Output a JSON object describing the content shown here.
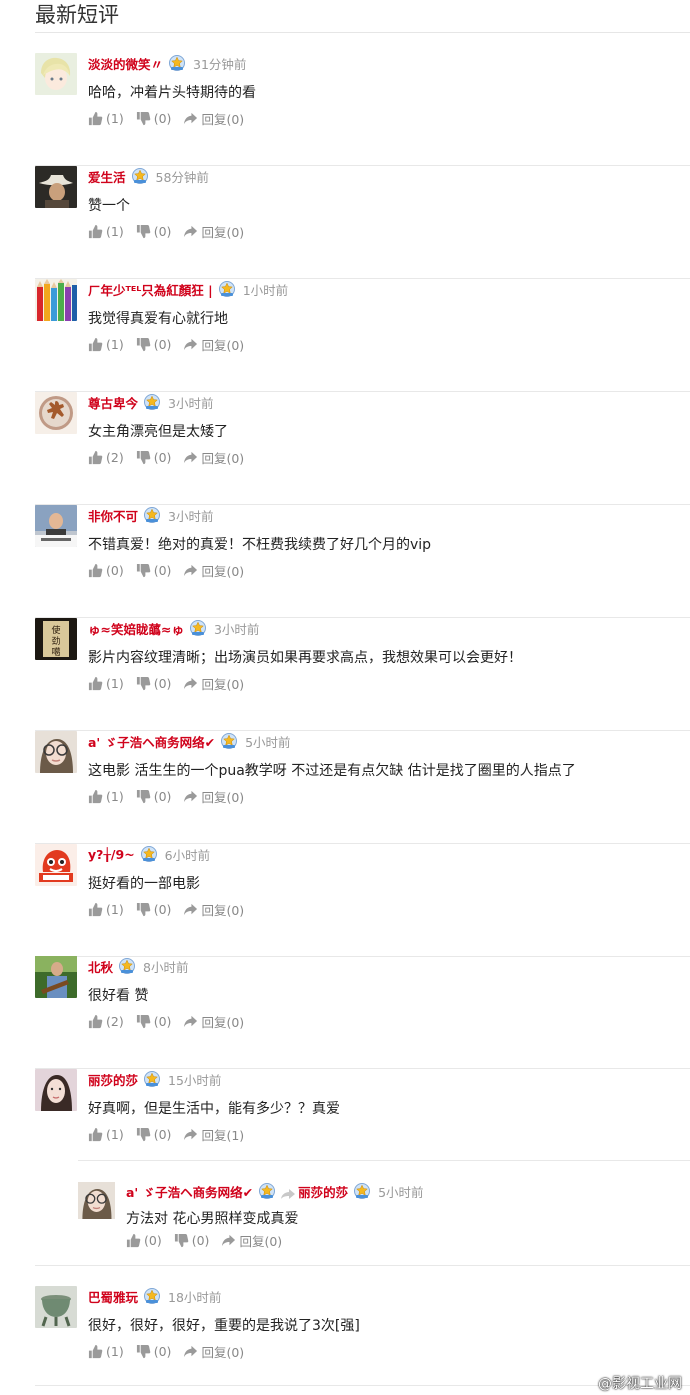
{
  "section": {
    "title": "最新短评"
  },
  "comments": [
    {
      "user": "淡淡的微笑〃",
      "time": "31分钟前",
      "text": "哈哈，冲着片头特期待的看",
      "like": "(1)",
      "dislike": "(0)",
      "reply": "回复(0)",
      "avatar": "anime-face"
    },
    {
      "user": "爱生活",
      "time": "58分钟前",
      "text": "赞一个",
      "like": "(1)",
      "dislike": "(0)",
      "reply": "回复(0)",
      "avatar": "cowboy"
    },
    {
      "user": "ㄏ年少ᵀᴱᴸ只為紅顏狂 |",
      "time": "1小时前",
      "text": "我觉得真爱有心就行地",
      "like": "(1)",
      "dislike": "(0)",
      "reply": "回复(0)",
      "avatar": "pencils"
    },
    {
      "user": "尊古卑今",
      "time": "3小时前",
      "text": "女主角漂亮但是太矮了",
      "like": "(2)",
      "dislike": "(0)",
      "reply": "回复(0)",
      "avatar": "cookie"
    },
    {
      "user": "非你不可",
      "time": "3小时前",
      "text": "不错真爱！绝对的真爱！不枉费我续费了好几个月的vip",
      "like": "(0)",
      "dislike": "(0)",
      "reply": "回复(0)",
      "avatar": "person-sign"
    },
    {
      "user": "ゅ≈笑婄眬蘤≈ゅ",
      "time": "3小时前",
      "text": "影片内容纹理清晰；出场演员如果再要求高点，我想效果可以会更好！",
      "like": "(1)",
      "dislike": "(0)",
      "reply": "回复(0)",
      "avatar": "calligraphy"
    },
    {
      "user": "a' ゞ子浩ヘ商务网络✔",
      "time": "5小时前",
      "text": "这电影 活生生的一个pua教学呀 不过还是有点欠缺 估计是找了圈里的人指点了",
      "like": "(1)",
      "dislike": "(0)",
      "reply": "回复(0)",
      "avatar": "girl"
    },
    {
      "user": "y?╁/9~",
      "time": "6小时前",
      "text": "挺好看的一部电影",
      "like": "(1)",
      "dislike": "(0)",
      "reply": "回复(0)",
      "avatar": "red-mascot"
    },
    {
      "user": "北秋",
      "time": "8小时前",
      "text": "很好看 赞",
      "like": "(2)",
      "dislike": "(0)",
      "reply": "回复(0)",
      "avatar": "guitar"
    },
    {
      "user": "丽莎的莎",
      "time": "15小时前",
      "text": "好真啊，但是生活中，能有多少？？真爱",
      "like": "(1)",
      "dislike": "(0)",
      "reply": "回复(1)",
      "avatar": "woman"
    },
    {
      "user": "巴蜀雅玩",
      "time": "18小时前",
      "text": "很好，很好，很好，重要的是我说了3次[强]",
      "like": "(1)",
      "dislike": "(0)",
      "reply": "回复(0)",
      "avatar": "vessel"
    }
  ],
  "reply": {
    "user": "a' ゞ子浩ヘ商务网络✔",
    "to_user": "丽莎的莎",
    "time": "5小时前",
    "text": "方法对 花心男照样变成真爱",
    "like": "(0)",
    "dislike": "(0)",
    "reply": "回复(0)",
    "avatar": "girl"
  },
  "watermark": "@影视工业网",
  "colors": {
    "username": "#d0021b",
    "muted": "#999999",
    "divider": "#e8e8e8"
  }
}
